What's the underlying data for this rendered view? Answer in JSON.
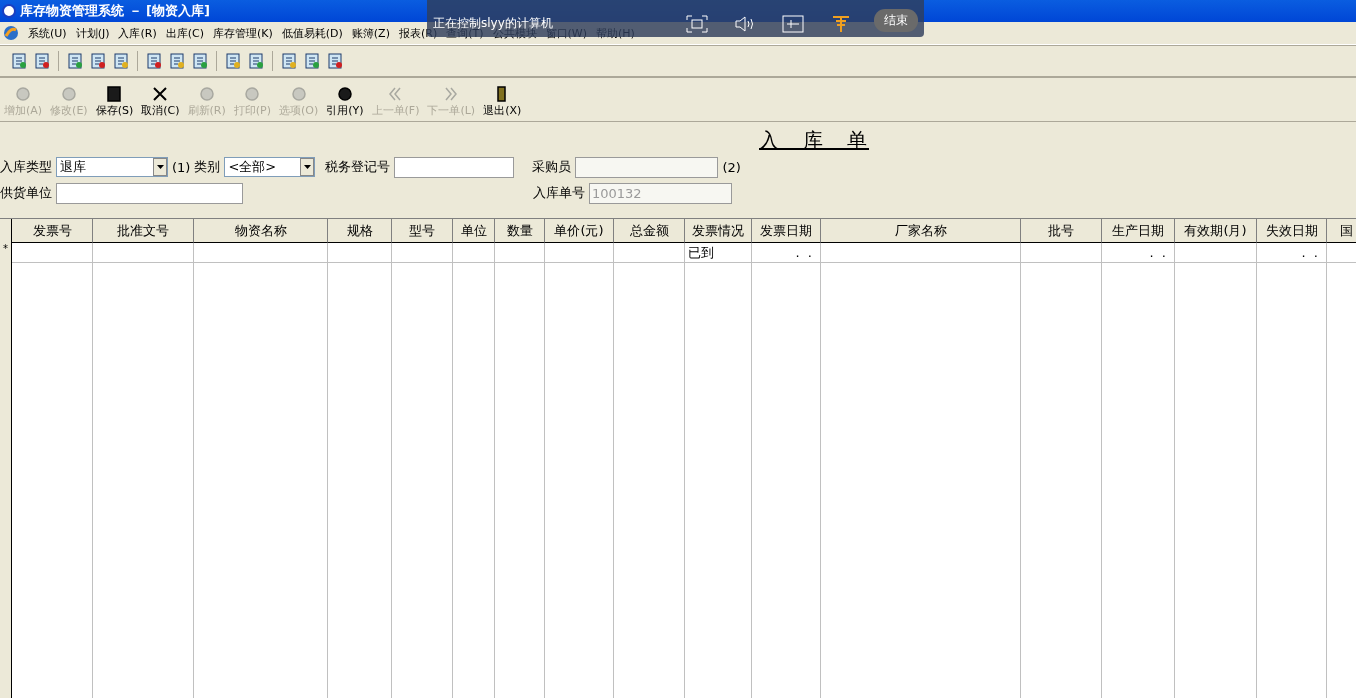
{
  "window": {
    "title": "库存物资管理系统 － [物资入库]"
  },
  "menu": [
    "系统(U)",
    "计划(J)",
    "入库(R)",
    "出库(C)",
    "库存管理(K)",
    "低值易耗(D)",
    "账簿(Z)",
    "报表(R)",
    "查询(T)",
    "公共模块",
    "窗口(W)",
    "帮助(H)"
  ],
  "remote_bar": {
    "title": "正在控制slyy的计算机",
    "end_button": "结束"
  },
  "actions": [
    {
      "label": "增加(A)",
      "disabled": true
    },
    {
      "label": "修改(E)",
      "disabled": true
    },
    {
      "label": "保存(S)",
      "disabled": false
    },
    {
      "label": "取消(C)",
      "disabled": false
    },
    {
      "label": "刷新(R)",
      "disabled": true
    },
    {
      "label": "打印(P)",
      "disabled": true
    },
    {
      "label": "选项(O)",
      "disabled": true
    },
    {
      "label": "引用(Y)",
      "disabled": false
    },
    {
      "label": "上一单(F)",
      "disabled": true
    },
    {
      "label": "下一单(L)",
      "disabled": true
    },
    {
      "label": "退出(X)",
      "disabled": false
    }
  ],
  "form": {
    "title": "入　库　单",
    "stock_type": {
      "label": "入库类型",
      "value": "退库",
      "note": "(1)"
    },
    "category": {
      "label": "类别",
      "value": "<全部>"
    },
    "tax_number": {
      "label": "税务登记号"
    },
    "buyer": {
      "label": "采购员",
      "disabled": true,
      "note": "(2)"
    },
    "supplier": {
      "label": "供货单位"
    },
    "receipt_number": {
      "label": "入库单号",
      "value": "100132",
      "disabled": true
    }
  },
  "table": {
    "columns": [
      "发票号",
      "批准文号",
      "物资名称",
      "规格",
      "型号",
      "单位",
      "数量",
      "单价(元)",
      "总金额",
      "发票情况",
      "发票日期",
      "厂家名称",
      "批号",
      "生产日期",
      "有效期(月)",
      "失效日期",
      "国"
    ],
    "rows": [
      {
        "marker": "*",
        "cells": [
          "",
          "",
          "",
          "",
          "",
          "",
          "",
          "",
          "",
          "已到",
          ".  .",
          "",
          "",
          ".  .",
          "",
          ".  .",
          ""
        ]
      }
    ]
  }
}
